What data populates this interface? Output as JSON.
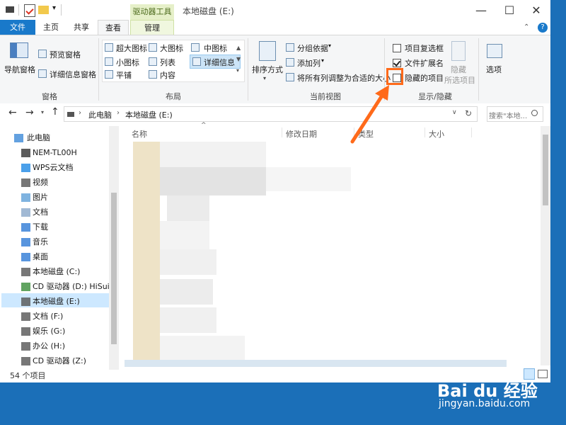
{
  "window": {
    "title": "本地磁盘 (E:)",
    "tool_tab_header": "驱动器工具",
    "controls": {
      "minimize": "—",
      "maximize": "☐",
      "close": "✕"
    }
  },
  "ribbon_tabs": [
    "文件",
    "主页",
    "共享",
    "查看",
    "管理"
  ],
  "ribbon": {
    "panes": {
      "nav_pane": "导航窗格",
      "preview_pane": "预览窗格",
      "details_pane": "详细信息窗格",
      "group_label": "窗格"
    },
    "layout": {
      "items": [
        "超大图标",
        "大图标",
        "中图标",
        "小图标",
        "列表",
        "详细信息",
        "平铺",
        "内容"
      ],
      "group_label": "布局"
    },
    "current_view": {
      "sort_by": "排序方式",
      "group_by": "分组依据",
      "add_columns": "添加列",
      "size_all_columns": "将所有列调整为合适的大小",
      "group_label": "当前视图"
    },
    "show_hide": {
      "item_checkboxes": "项目复选框",
      "file_extensions": "文件扩展名",
      "hidden_items": "隐藏的项目",
      "hide_selected": "隐藏",
      "hide_selected_2": "所选项目",
      "group_label": "显示/隐藏",
      "item_checkboxes_checked": false,
      "file_extensions_checked": true,
      "hidden_items_checked": false
    },
    "options": "选项"
  },
  "address": {
    "path": [
      "此电脑",
      "本地磁盘 (E:)"
    ],
    "search_placeholder": "搜索\"本地...",
    "search_icon": "search-icon"
  },
  "nav_pane": {
    "items": [
      {
        "label": "此电脑",
        "icon": "computer-icon"
      },
      {
        "label": "NEM-TL00H",
        "icon": "phone-icon"
      },
      {
        "label": "WPS云文档",
        "icon": "cloud-icon"
      },
      {
        "label": "视频",
        "icon": "video-icon"
      },
      {
        "label": "图片",
        "icon": "picture-icon"
      },
      {
        "label": "文档",
        "icon": "document-icon"
      },
      {
        "label": "下载",
        "icon": "download-icon"
      },
      {
        "label": "音乐",
        "icon": "music-icon"
      },
      {
        "label": "桌面",
        "icon": "desktop-icon"
      },
      {
        "label": "本地磁盘 (C:)",
        "icon": "drive-icon"
      },
      {
        "label": "CD 驱动器 (D:) HiSuite",
        "icon": "cd-icon"
      },
      {
        "label": "本地磁盘 (E:)",
        "icon": "drive-icon"
      },
      {
        "label": "文档 (F:)",
        "icon": "drive-icon"
      },
      {
        "label": "娱乐 (G:)",
        "icon": "drive-icon"
      },
      {
        "label": "办公 (H:)",
        "icon": "drive-icon"
      },
      {
        "label": "CD 驱动器 (Z:)",
        "icon": "cd-icon"
      }
    ],
    "selected_index": 11
  },
  "columns": [
    "名称",
    "修改日期",
    "类型",
    "大小"
  ],
  "status": {
    "item_count": "54 个项目"
  },
  "colors": {
    "accent": "#1979ca",
    "annotation": "#ff6a1a",
    "tool_tab": "#e6f0c9"
  },
  "watermark": {
    "brand": "Bai du 经验",
    "url": "jingyan.baidu.com"
  }
}
